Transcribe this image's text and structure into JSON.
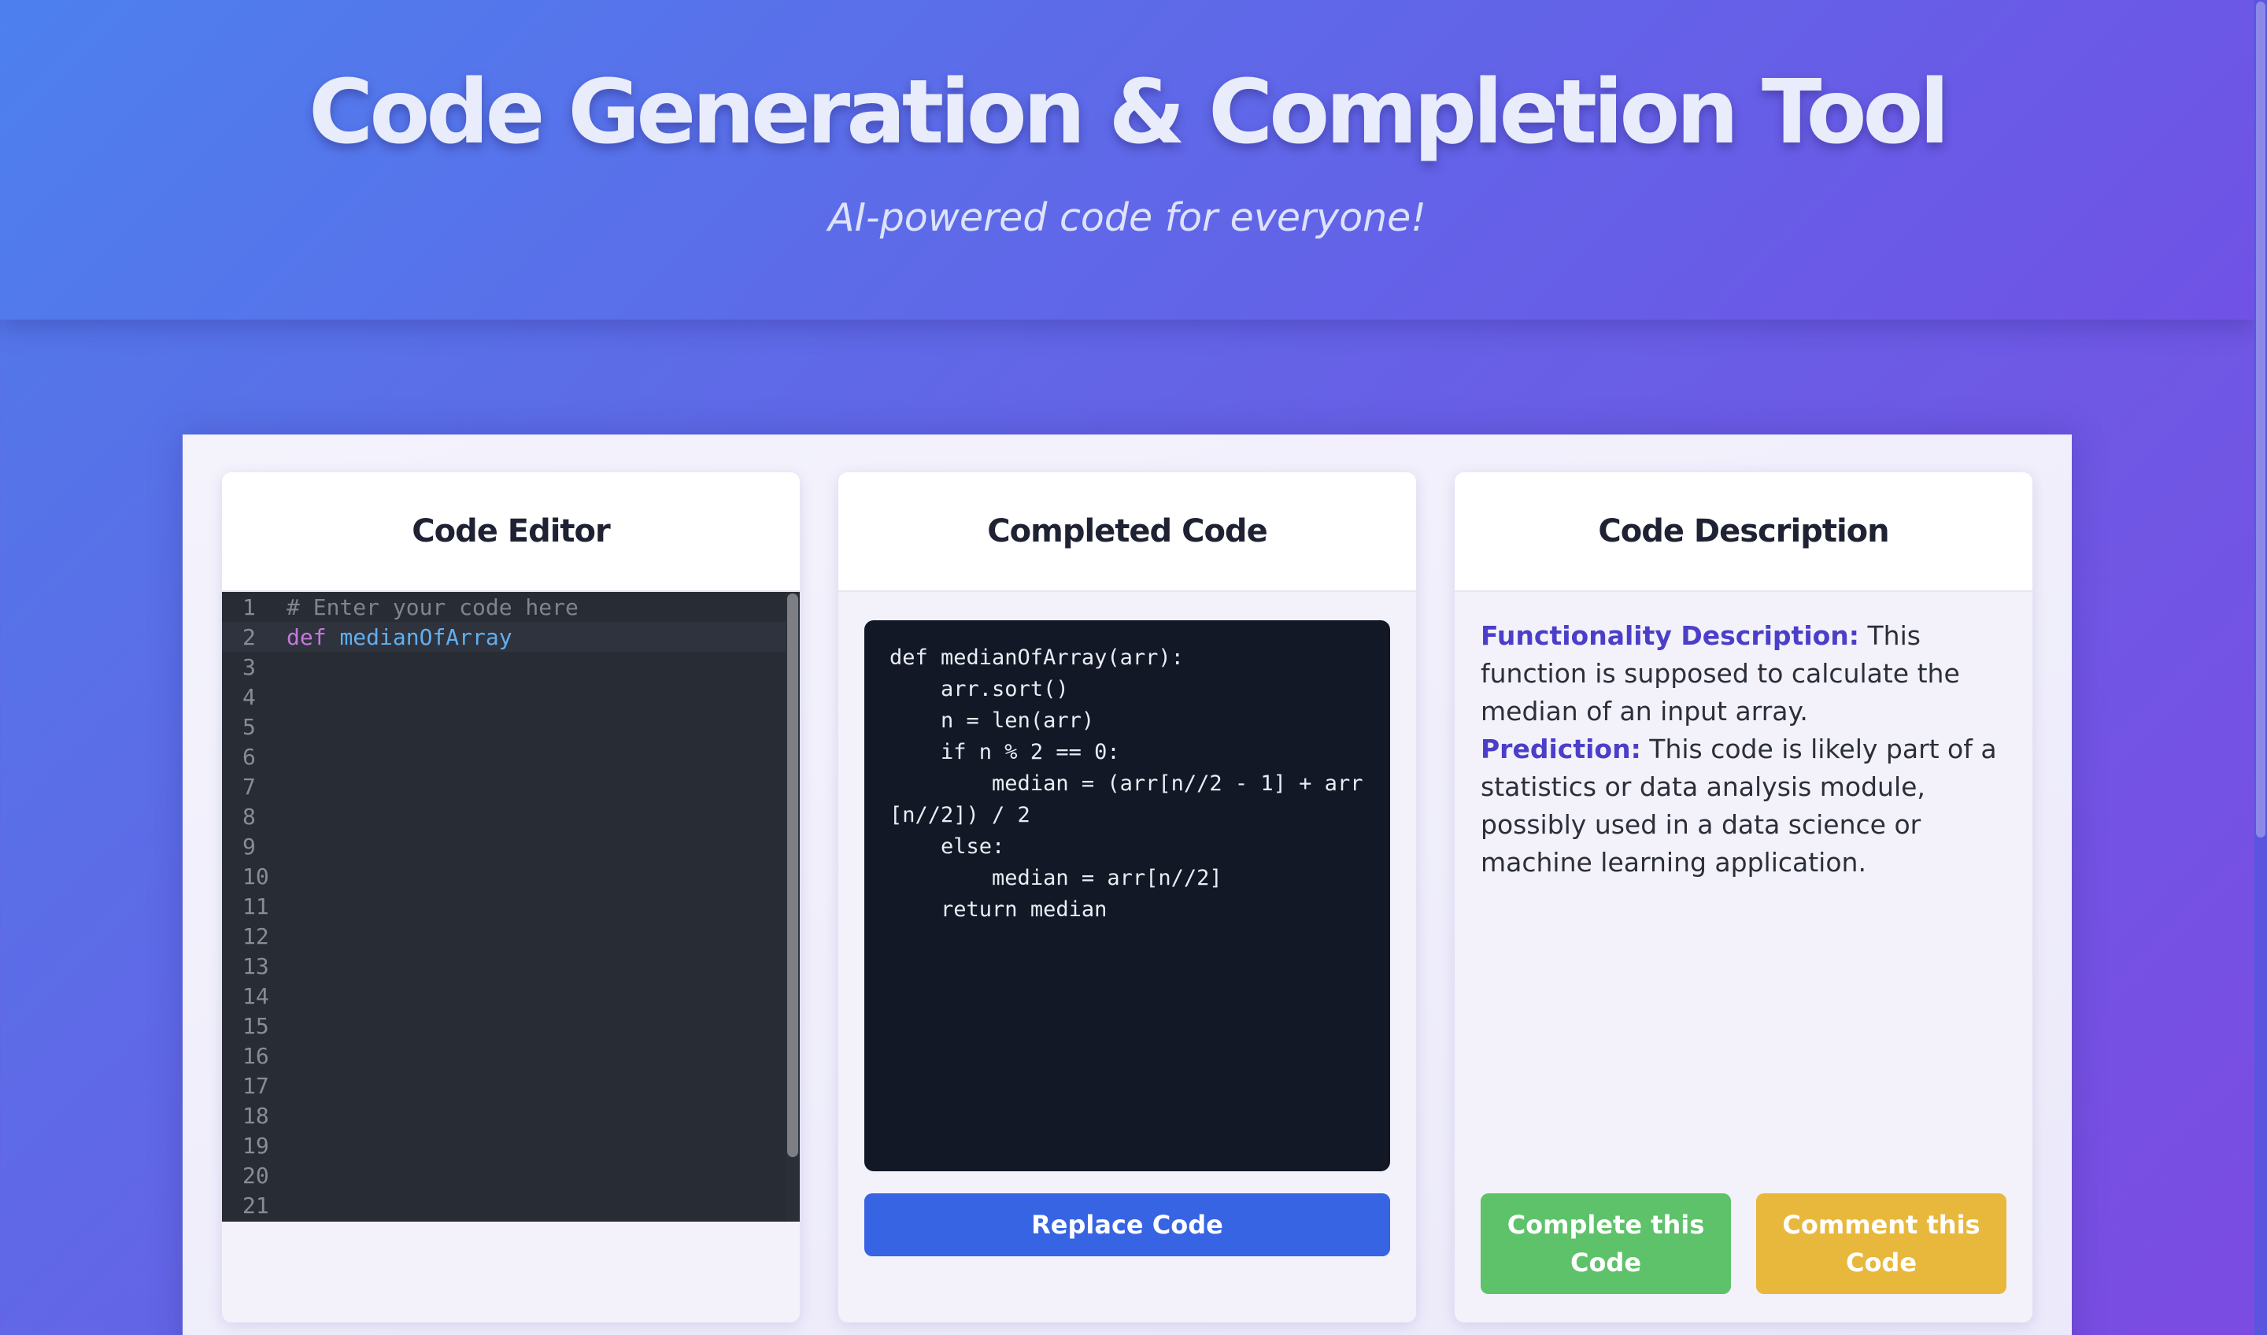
{
  "header": {
    "title": "Code Generation & Completion Tool",
    "subtitle": "AI-powered code for everyone!"
  },
  "editor": {
    "heading": "Code Editor",
    "line_numbers": [
      "1",
      "2",
      "3",
      "4",
      "5",
      "6",
      "7",
      "8",
      "9",
      "10",
      "11",
      "12",
      "13",
      "14",
      "15",
      "16",
      "17",
      "18",
      "19",
      "20",
      "21"
    ],
    "line1_comment": "# Enter your code here",
    "line2_keyword": "def",
    "line2_name": "medianOfArray"
  },
  "completed": {
    "heading": "Completed Code",
    "code": "def medianOfArray(arr):\n    arr.sort()\n    n = len(arr)\n    if n % 2 == 0:\n        median = (arr[n//2 - 1] + arr[n//2]) / 2\n    else:\n        median = arr[n//2]\n    return median",
    "replace_label": "Replace Code"
  },
  "description": {
    "heading": "Code Description",
    "functionality_label": "Functionality Description:",
    "functionality_text": " This function is supposed to calculate the median of an input array.",
    "prediction_label": "Prediction:",
    "prediction_text": " This code is likely part of a statistics or data analysis module, possibly used in a data science or machine learning application.",
    "complete_label": "Complete this Code",
    "comment_label": "Comment this Code"
  },
  "colors": {
    "accent_blue": "#3764e3",
    "accent_green": "#5ec26a",
    "accent_yellow": "#e8b83c",
    "label_purple": "#4b3fc9"
  }
}
